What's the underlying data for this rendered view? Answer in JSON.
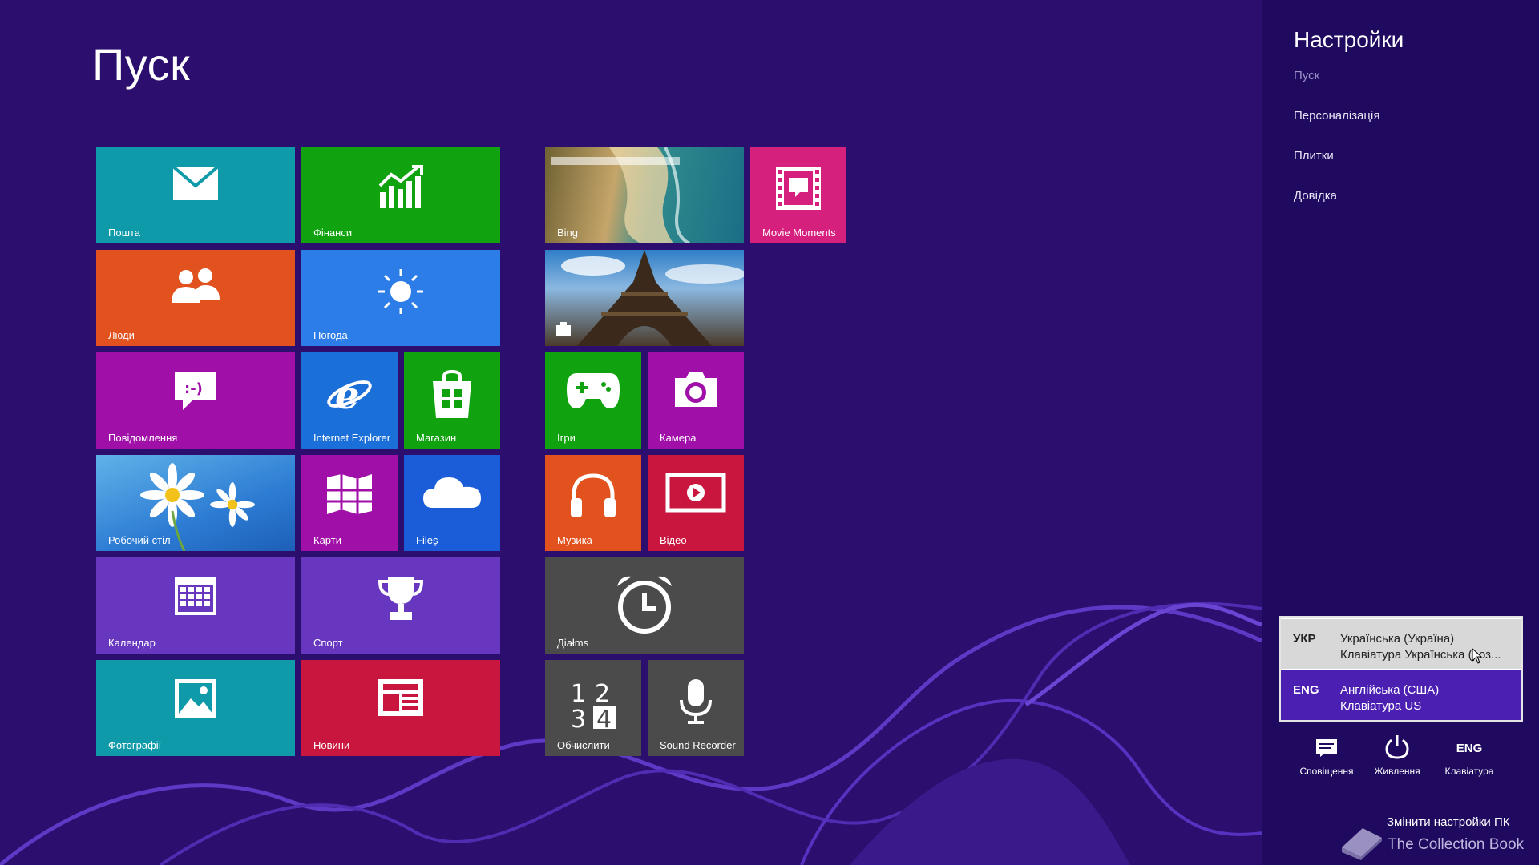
{
  "start": {
    "title": "Пуск"
  },
  "tiles": {
    "mail": "Пошта",
    "finance": "Фінанси",
    "people": "Люди",
    "weather": "Погода",
    "messaging": "Повідомлення",
    "ie": "Internet Explorer",
    "store": "Магазин",
    "desktop": "Робочий стіл",
    "maps": "Карти",
    "files": "Fileş",
    "calendar": "Календар",
    "sport": "Спорт",
    "photos": "Фотографії",
    "news": "Новини",
    "bing": "Bing",
    "movie": "Movie Moments",
    "games": "Ігри",
    "camera": "Камера",
    "music": "Музика",
    "video": "Відео",
    "alarms": "Діаłms",
    "calculator": "Обчислити",
    "recorder": "Sound Recorder"
  },
  "charms": {
    "title": "Настройки",
    "items": [
      "Пуск",
      "Персоналізація",
      "Плитки",
      "Довідка"
    ]
  },
  "languages": [
    {
      "code": "УКР",
      "name": "Українська (Україна)",
      "keyboard": "Клавіатура Українська (роз..."
    },
    {
      "code": "ENG",
      "name": "Англійська (США)",
      "keyboard": "Клавіатура US"
    }
  ],
  "system": {
    "notifications": "Сповіщення",
    "power": "Живлення",
    "keyboard_code": "ENG",
    "keyboard": "Клавіатура"
  },
  "footer": {
    "change_settings": "Змінити настройки ПК",
    "watermark": "The Collection Book"
  },
  "colors": {
    "background": "#2b0e6e",
    "teal": "#0f9aa9",
    "green": "#10a30f",
    "orange": "#e2521f",
    "blue": "#2d7de8",
    "magenta": "#a010a8",
    "purple": "#6737c0",
    "crimson": "#c9163f",
    "pink": "#d6207e",
    "darkblue": "#1b5dd8",
    "gray": "#4b4b4b"
  }
}
